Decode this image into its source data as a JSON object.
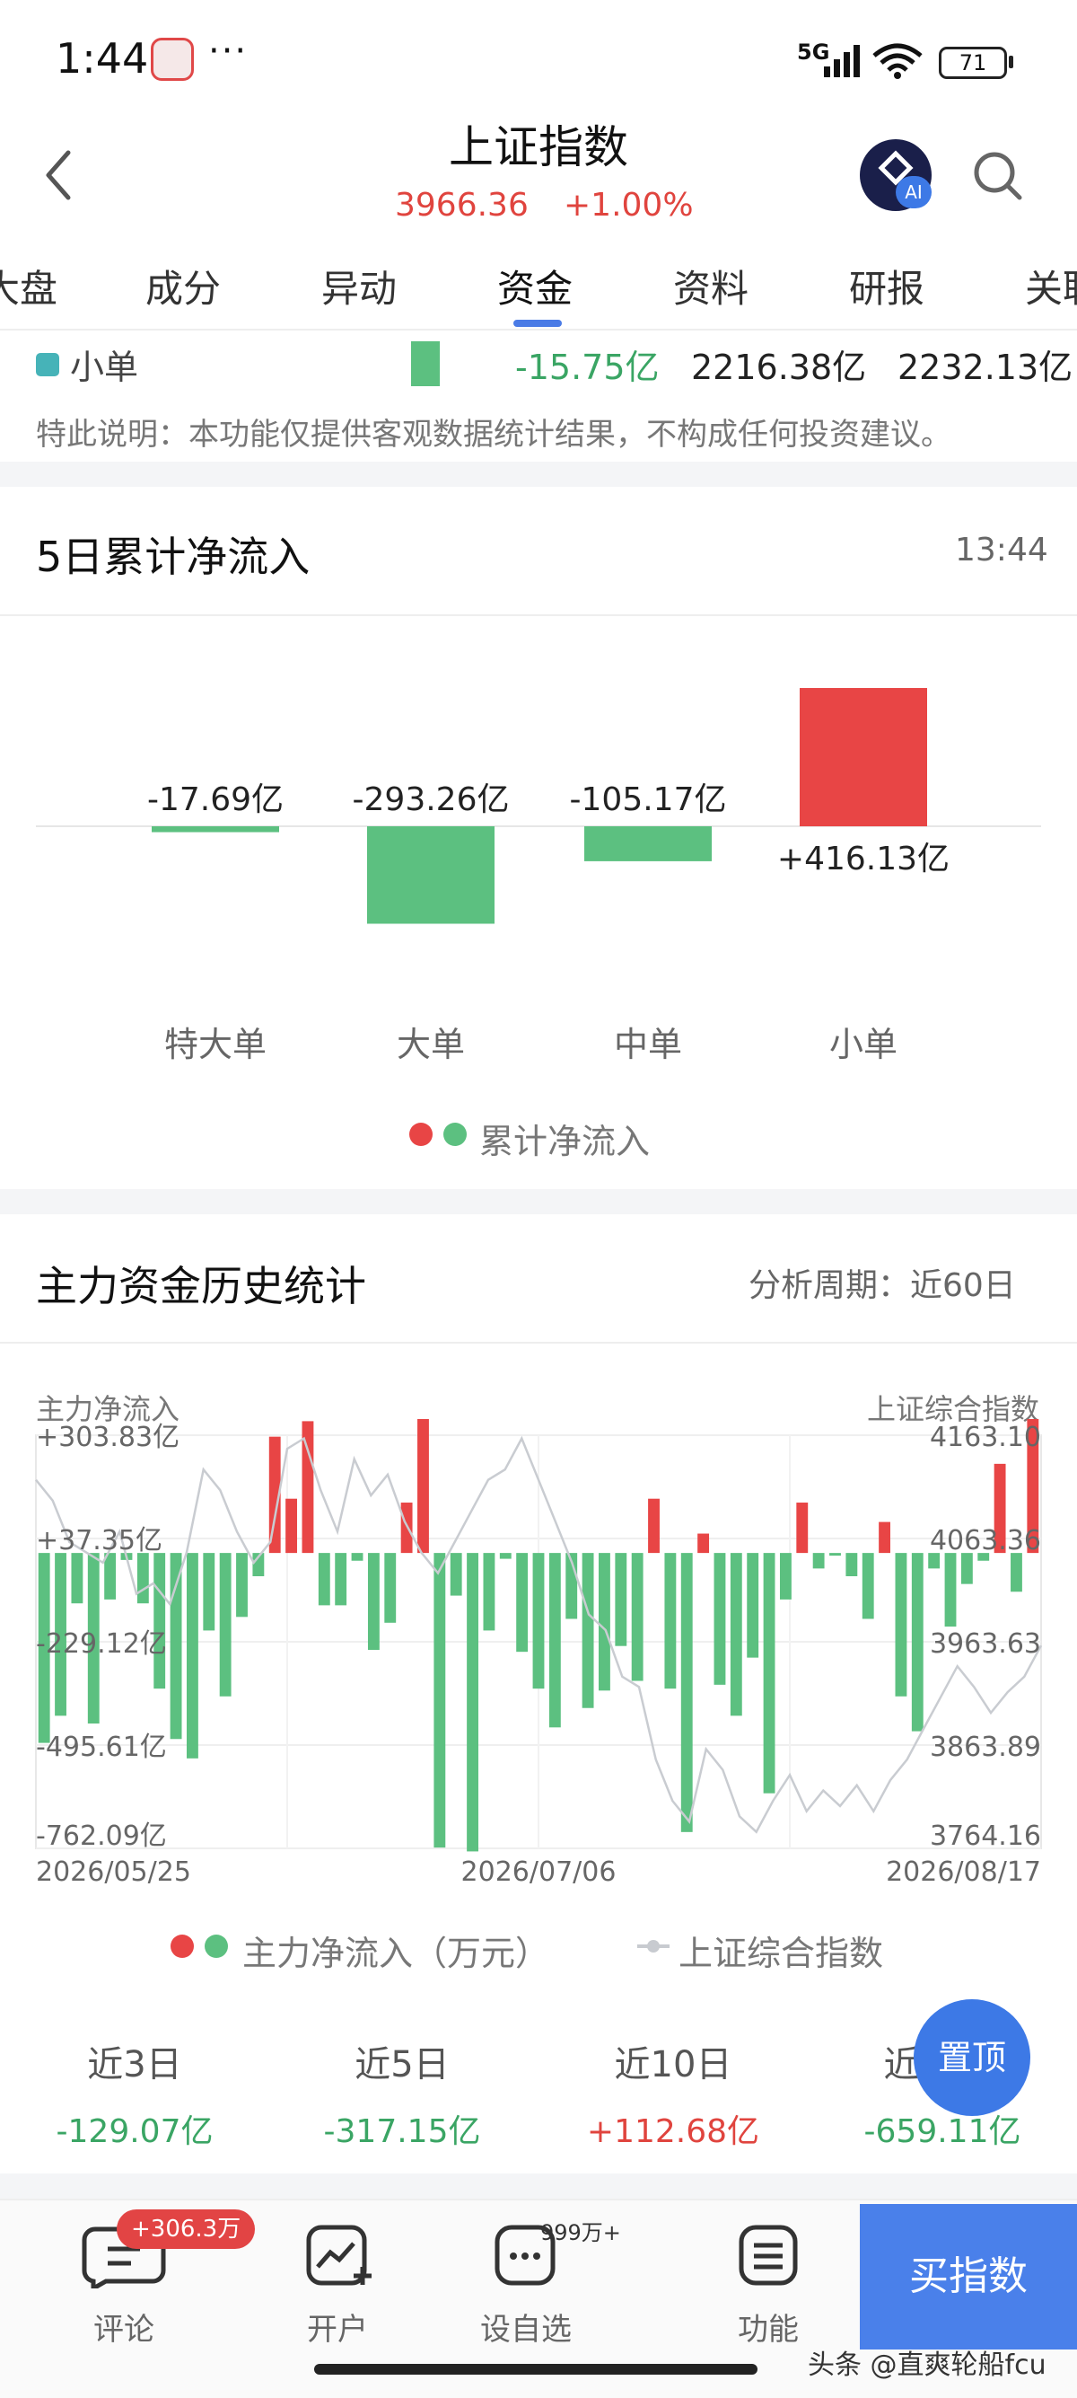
{
  "status": {
    "time": "1:44",
    "dots": "···",
    "network": "5G",
    "battery": "71"
  },
  "header": {
    "title": "上证指数",
    "price": "3966.36",
    "change": "+1.00%",
    "ai_badge": "AI"
  },
  "tabs": [
    {
      "label": "大盘"
    },
    {
      "label": "成分"
    },
    {
      "label": "异动"
    },
    {
      "label": "资金",
      "active": true
    },
    {
      "label": "资料"
    },
    {
      "label": "研报"
    },
    {
      "label": "关联"
    }
  ],
  "small_order_row": {
    "label": "小单",
    "net": "-15.75亿",
    "inflow": "2216.38亿",
    "outflow": "2232.13亿"
  },
  "disclaimer": "特此说明：本功能仅提供客观数据统计结果，不构成任何投资建议。",
  "five_day": {
    "title": "5日累计净流入",
    "time": "13:44",
    "legend": "累计净流入",
    "colors": {
      "up": "#e84545",
      "down": "#5cc080"
    }
  },
  "history": {
    "title": "主力资金历史统计",
    "period_label": "分析周期：近60日",
    "left_axis_title": "主力净流入",
    "right_axis_title": "上证综合指数",
    "left_ticks": [
      "+303.83亿",
      "+37.35亿",
      "-229.12亿",
      "-495.61亿",
      "-762.09亿"
    ],
    "right_ticks": [
      "4163.10",
      "4063.36",
      "3963.63",
      "3863.89",
      "3764.16"
    ],
    "dates": [
      "2026/05/25",
      "2026/07/06",
      "2026/08/17"
    ],
    "legend_bar": "主力净流入（万元）",
    "legend_line": "上证综合指数"
  },
  "periods": [
    {
      "label": "近3日",
      "value": "-129.07亿",
      "dir": "down"
    },
    {
      "label": "近5日",
      "value": "-317.15亿",
      "dir": "down"
    },
    {
      "label": "近10日",
      "value": "+112.68亿",
      "dir": "up"
    },
    {
      "label": "近20日",
      "value": "-659.11亿",
      "dir": "down"
    }
  ],
  "fab": {
    "label": "置顶"
  },
  "bottom_bar": {
    "comment": "评论",
    "comment_badge": "+306.3万",
    "open": "开户",
    "watch": "设自选",
    "watch_badge": "999万+",
    "func": "功能",
    "buy": "买指数"
  },
  "watermark": "头条 @直爽轮船fcu",
  "chart_data": [
    {
      "type": "bar",
      "title": "5日累计净流入",
      "categories": [
        "特大单",
        "大单",
        "中单",
        "小单"
      ],
      "values": [
        -17.69,
        -293.26,
        -105.17,
        416.13
      ],
      "value_labels": [
        "-17.69亿",
        "-293.26亿",
        "-105.17亿",
        "+416.13亿"
      ],
      "unit": "亿",
      "legend": "累计净流入",
      "legend_position": "bottom-center",
      "grid": false
    },
    {
      "type": "bar",
      "title": "主力资金历史统计",
      "x_start": "2026/05/25",
      "x_mid": "2026/07/06",
      "x_end": "2026/08/17",
      "x_tick_labels": [
        "2026/05/25",
        "2026/07/06",
        "2026/08/17"
      ],
      "series": [
        {
          "name": "主力净流入（万元）",
          "unit": "亿",
          "values": [
            -490,
            -420,
            -130,
            -440,
            -120,
            -18,
            -130,
            -350,
            -480,
            -530,
            -200,
            -370,
            -165,
            -60,
            300,
            140,
            340,
            -135,
            -135,
            -20,
            -250,
            -180,
            130,
            490,
            -760,
            -110,
            -770,
            -200,
            -15,
            -255,
            -350,
            -450,
            -170,
            -400,
            -355,
            -240,
            -330,
            140,
            -350,
            -720,
            50,
            -340,
            -420,
            -270,
            -620,
            -120,
            130,
            -40,
            -5,
            -60,
            -170,
            80,
            -370,
            -460,
            -40,
            -190,
            -80,
            -20,
            230,
            -100,
            420
          ]
        },
        {
          "name": "上证综合指数",
          "type": "line",
          "values": [
            4120,
            4100,
            4060,
            4050,
            4040,
            4070,
            4010,
            4020,
            4000,
            4050,
            4130,
            4110,
            4070,
            4040,
            4060,
            4150,
            4160,
            4110,
            4070,
            4140,
            4105,
            4125,
            4080,
            4050,
            4030,
            4060,
            4090,
            4120,
            4130,
            4160,
            4120,
            4080,
            4040,
            3990,
            3975,
            3930,
            3920,
            3850,
            3810,
            3790,
            3860,
            3840,
            3795,
            3780,
            3810,
            3835,
            3800,
            3820,
            3805,
            3825,
            3800,
            3830,
            3850,
            3880,
            3910,
            3940,
            3920,
            3895,
            3915,
            3930,
            3960
          ]
        }
      ],
      "left_ylim": [
        -762.09,
        303.83
      ],
      "right_ylim": [
        3764.16,
        4163.1
      ],
      "legend_position": "bottom-center",
      "grid": true
    }
  ]
}
